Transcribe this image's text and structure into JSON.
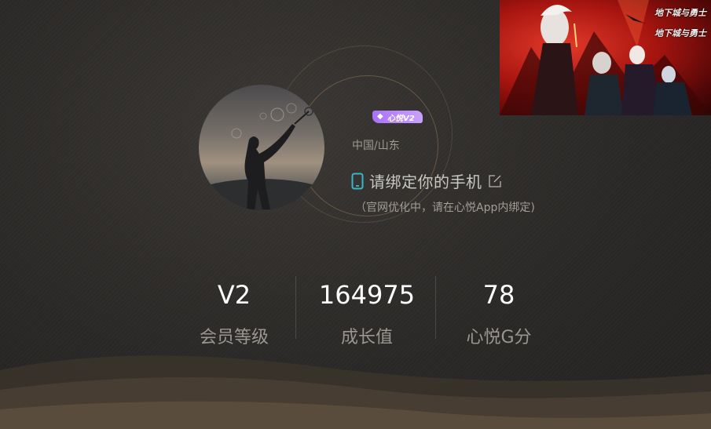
{
  "profile": {
    "vip_badge": "心悦V2",
    "region": "中国/山东",
    "bind_phone": "请绑定你的手机",
    "bind_note": "（官网优化中，请在心悦App内绑定)"
  },
  "stats": [
    {
      "value": "V2",
      "label": "会员等级"
    },
    {
      "value": "164975",
      "label": "成长值"
    },
    {
      "value": "78",
      "label": "心悦G分"
    }
  ],
  "banner": {
    "logo_text": "地下城与勇士"
  },
  "colors": {
    "accent_purple": "#b184f7",
    "phone_icon": "#37b7c9",
    "stat_value": "#ffffff",
    "stat_label": "#9a9690"
  },
  "icons": [
    "phone-icon",
    "edit-icon",
    "vip-gem-icon"
  ]
}
